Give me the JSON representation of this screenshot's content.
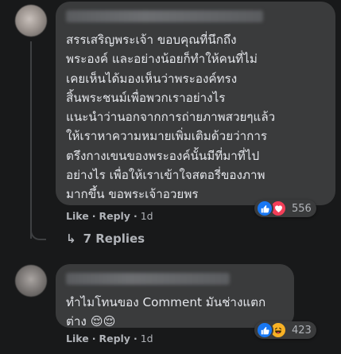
{
  "comments": [
    {
      "text": "สรรเสริญพระเจ้า ขอบคุณที่นึกถึง\nพระองค์ และอย่างน้อยก็ทำให้คนที่ไม่\nเคยเห็นได้มองเห็นว่าพระองค์ทรง\nสิ้นพระชนม์เพื่อพวกเราอย่างไร\nแนะนำว่านอกจากการถ่ายภาพสวยๆแล้ว\nให้เราหาความหมายเพิ่มเติมด้วยว่าการ\nตรึงกางเขนของพระองค์นั้นมีที่มาที่ไป\nอย่างไร เพื่อให้เราเข้าใจสตอรี่ของภาพ\nมากขึ้น ขอพระเจ้าอวยพร",
      "like_label": "Like",
      "reply_label": "Reply",
      "separator": "·",
      "time": "1d",
      "reaction_count": "556",
      "reactions": [
        "like-icon",
        "love-icon"
      ]
    },
    {
      "text": "ทำไมโทนของ Comment มันช่างแตก\nต่าง 😌😌",
      "like_label": "Like",
      "reply_label": "Reply",
      "separator": "·",
      "time": "1d",
      "reaction_count": "423",
      "reactions": [
        "like-icon",
        "haha-icon"
      ]
    }
  ],
  "replies_link": {
    "arrow": "↳",
    "label": "7 Replies"
  },
  "colors": {
    "background": "#18191a",
    "bubble": "#3a3b3c",
    "text": "#e4e6eb",
    "secondary_text": "#b0b3b8",
    "like_blue": "#1877f2",
    "love_red": "#f33e58",
    "haha_yellow": "#f7b125"
  }
}
